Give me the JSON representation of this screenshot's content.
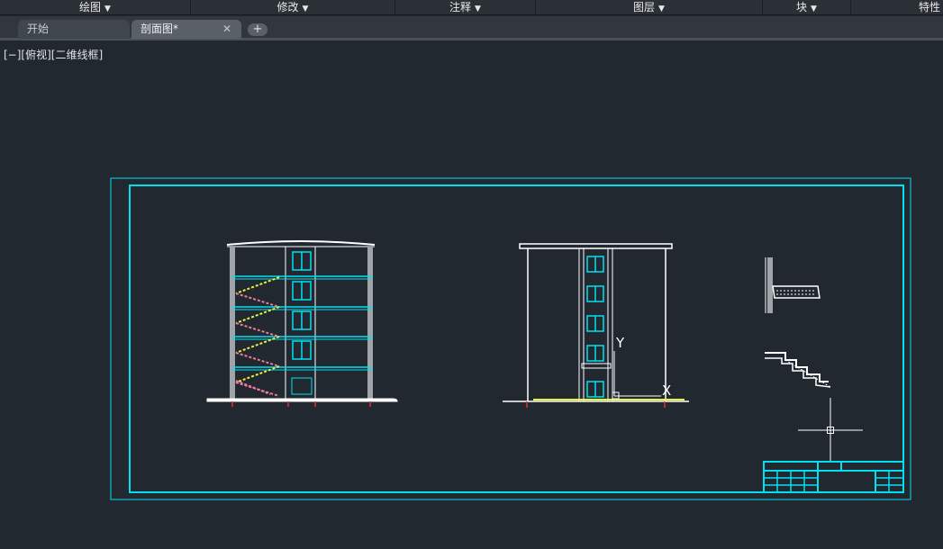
{
  "ribbon": {
    "panels": [
      {
        "label": "绘图",
        "has_dropdown": true
      },
      {
        "label": "修改",
        "has_dropdown": true
      },
      {
        "label": "注释",
        "has_dropdown": true
      },
      {
        "label": "图层",
        "has_dropdown": true
      },
      {
        "label": "块",
        "has_dropdown": true
      },
      {
        "label": "特性",
        "has_dropdown": false
      }
    ],
    "dropdown_glyph": "▼"
  },
  "tabs": {
    "items": [
      {
        "label": "开始",
        "active": false
      },
      {
        "label": "剖面图*",
        "active": true
      }
    ],
    "close_glyph": "✕",
    "add_glyph": "+"
  },
  "viewport": {
    "label": "[−][俯视][二维线框]"
  },
  "ucs": {
    "y_label": "Y",
    "x_label": "X"
  },
  "colors": {
    "background": "#212830",
    "cyan": "#00e0f0",
    "white": "#ffffff",
    "yellow": "#e8f040",
    "pink": "#f07a9a",
    "red": "#e03030",
    "gray": "#a0a4a8"
  }
}
